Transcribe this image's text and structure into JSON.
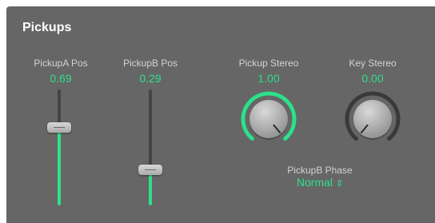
{
  "section": {
    "title": "Pickups"
  },
  "colors": {
    "accent": "#2ee08b",
    "panel": "#666666",
    "track_off": "#444444",
    "arc_off": "#3a3a3a"
  },
  "controls": {
    "pickup_a_pos": {
      "label": "PickupA Pos",
      "value": "0.69",
      "level": 0.69
    },
    "pickup_b_pos": {
      "label": "PickupB Pos",
      "value": "0.29",
      "level": 0.29
    },
    "pickup_stereo": {
      "label": "Pickup Stereo",
      "value": "1.00",
      "level": 1.0
    },
    "key_stereo": {
      "label": "Key Stereo",
      "value": "0.00",
      "level": 0.0
    },
    "pickup_b_phase": {
      "label": "PickupB Phase",
      "value": "Normal",
      "icon": "updown-chevron-icon"
    }
  }
}
